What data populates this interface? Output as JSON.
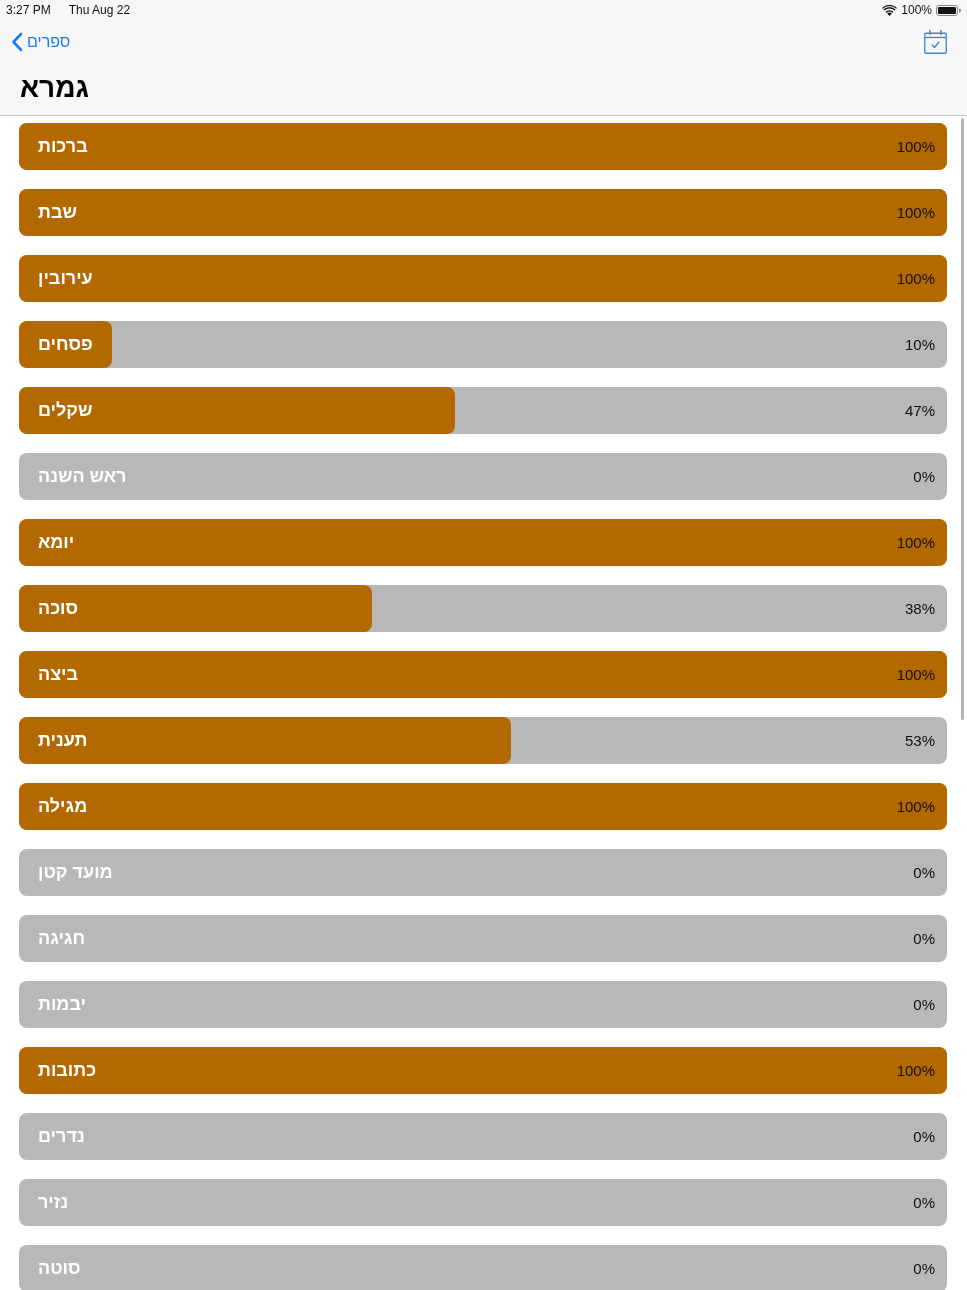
{
  "status_bar": {
    "time": "3:27 PM",
    "date": "Thu Aug 22",
    "battery": "100%"
  },
  "nav_bar": {
    "back_label": "ספרים"
  },
  "title": "גמרא",
  "tractates": [
    {
      "name": "ברכות",
      "level": 1,
      "percent": "100%"
    },
    {
      "name": "שבת",
      "level": 1,
      "percent": "100%"
    },
    {
      "name": "עירובין",
      "level": 1,
      "percent": "100%"
    },
    {
      "name": "פסחים",
      "level": 0.1,
      "percent": "10%"
    },
    {
      "name": "שקלים",
      "level": 0.47,
      "percent": "47%"
    },
    {
      "name": "ראש השנה",
      "level": 0,
      "percent": "0%"
    },
    {
      "name": "יומא",
      "level": 1,
      "percent": "100%"
    },
    {
      "name": "סוכה",
      "level": 0.38,
      "percent": "38%"
    },
    {
      "name": "ביצה",
      "level": 1,
      "percent": "100%"
    },
    {
      "name": "תענית",
      "level": 0.53,
      "percent": "53%"
    },
    {
      "name": "מגילה",
      "level": 1,
      "percent": "100%"
    },
    {
      "name": "מועד קטן",
      "level": 0,
      "percent": "0%"
    },
    {
      "name": "חגיגה",
      "level": 0,
      "percent": "0%"
    },
    {
      "name": "יבמות",
      "level": 0,
      "percent": "0%"
    },
    {
      "name": "כתובות",
      "level": 1,
      "percent": "100%"
    },
    {
      "name": "נדרים",
      "level": 0,
      "percent": "0%"
    },
    {
      "name": "נזיר",
      "level": 0,
      "percent": "0%"
    },
    {
      "name": "סוטה",
      "level": 0,
      "percent": "0%"
    }
  ]
}
